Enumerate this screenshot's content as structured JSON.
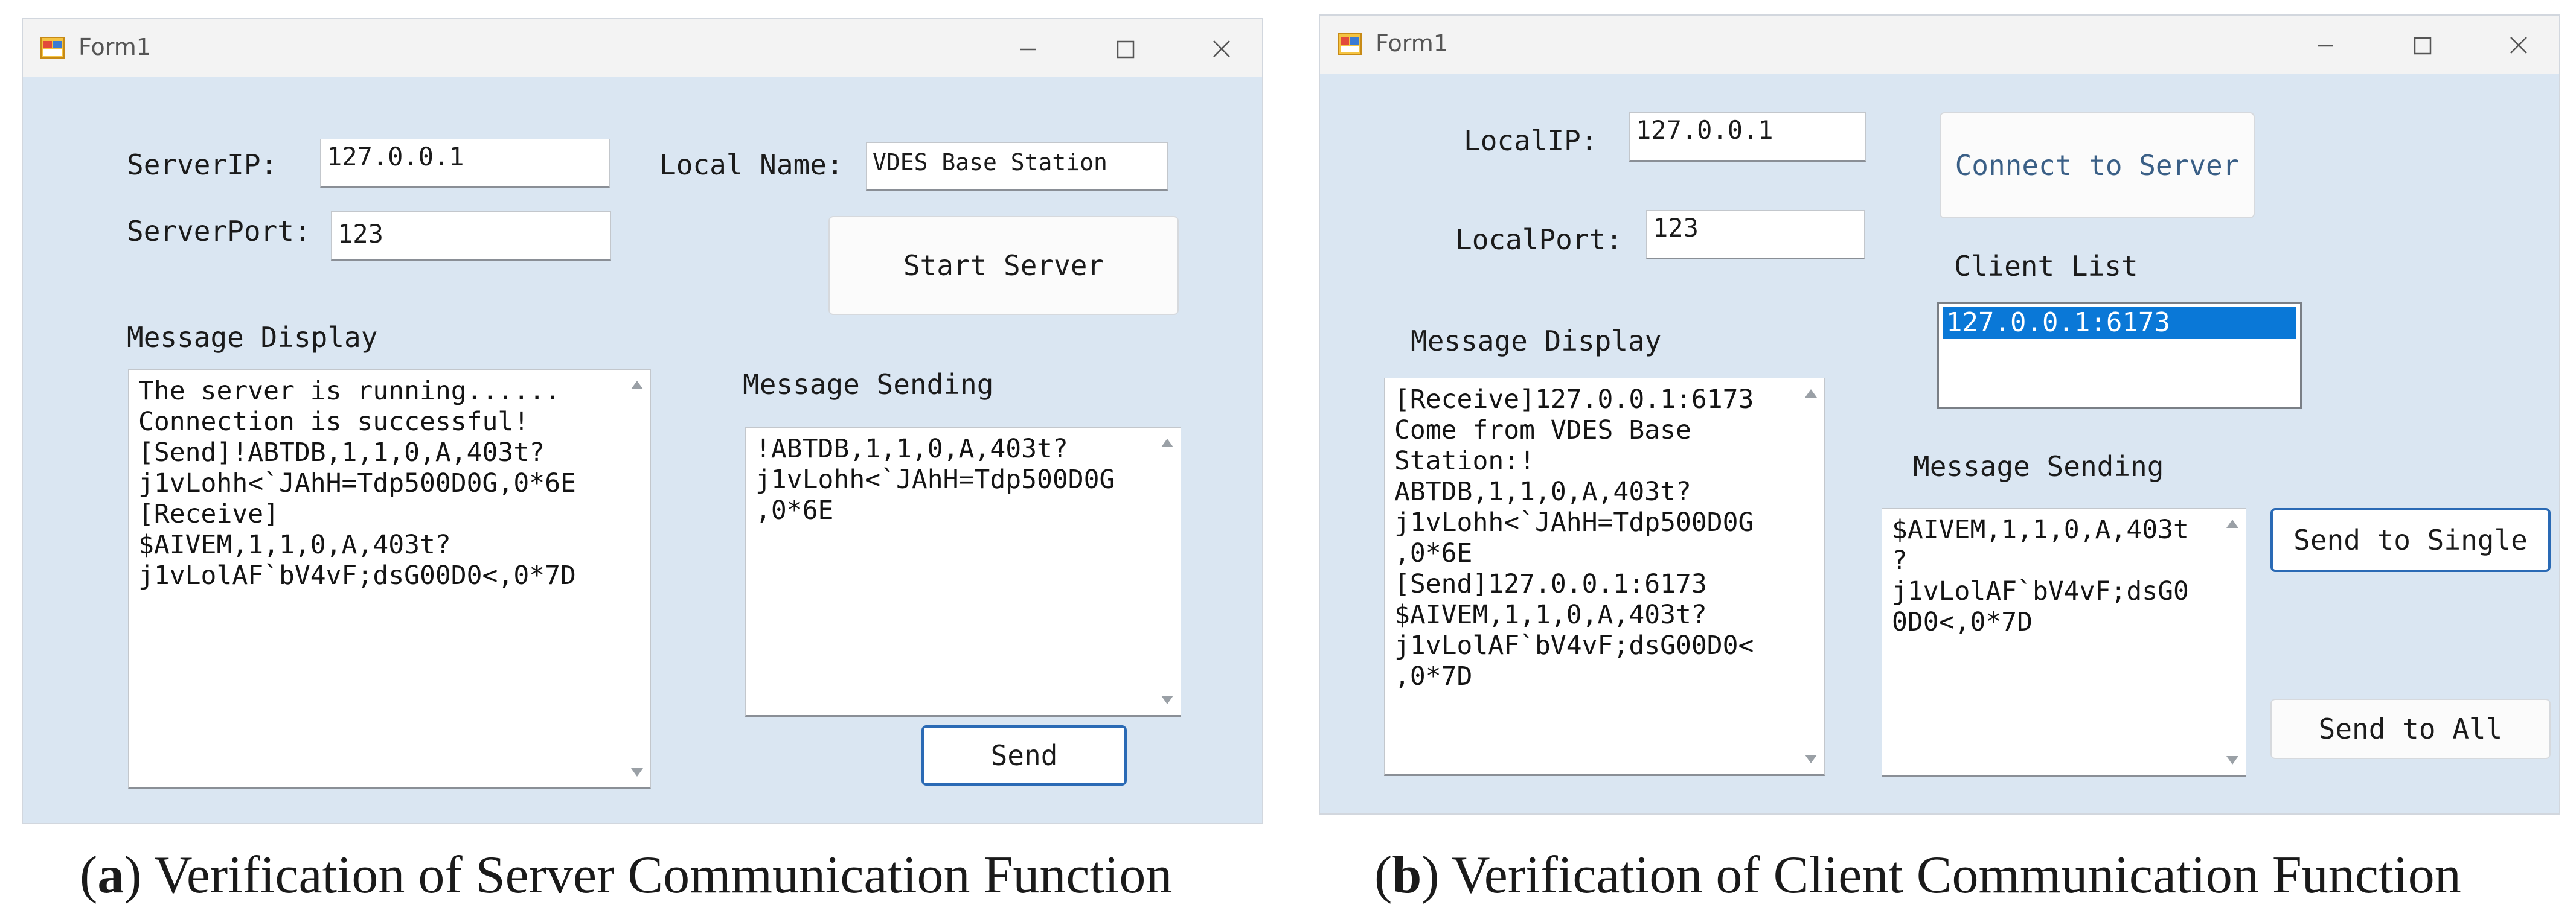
{
  "server_window": {
    "title": "Form1",
    "server_ip_label": "ServerIP:",
    "server_ip_value": "127.0.0.1",
    "local_name_label": "Local Name:",
    "local_name_value": "VDES Base Station",
    "server_port_label": "ServerPort:",
    "server_port_value": "123",
    "start_server_label": "Start Server",
    "message_display_label": "Message Display",
    "message_display_lines": [
      "The server is running......",
      "Connection is successful!",
      "[Send]!ABTDB,1,1,0,A,403t?",
      "j1vLohh<`JAhH=Tdp500D0G,0*6E",
      "[Receive]",
      "$AIVEM,1,1,0,A,403t?",
      "j1vLolAF`bV4vF;dsG00D0<,0*7D"
    ],
    "message_sending_label": "Message Sending",
    "message_sending_lines": [
      "!ABTDB,1,1,0,A,403t?",
      "j1vLohh<`JAhH=Tdp500D0G",
      ",0*6E"
    ],
    "send_label": "Send"
  },
  "client_window": {
    "title": "Form1",
    "local_ip_label": "LocalIP:",
    "local_ip_value": "127.0.0.1",
    "local_port_label": "LocalPort:",
    "local_port_value": "123",
    "connect_label": "Connect to Server",
    "client_list_label": "Client List",
    "client_list_items": [
      "127.0.0.1:6173"
    ],
    "message_display_label": "Message Display",
    "message_display_lines": [
      "[Receive]127.0.0.1:6173",
      "Come from VDES Base",
      "Station:!",
      "ABTDB,1,1,0,A,403t?",
      "j1vLohh<`JAhH=Tdp500D0G",
      ",0*6E",
      "[Send]127.0.0.1:6173",
      "$AIVEM,1,1,0,A,403t?",
      "j1vLolAF`bV4vF;dsG00D0<",
      ",0*7D"
    ],
    "message_sending_label": "Message Sending",
    "message_sending_lines": [
      "$AIVEM,1,1,0,A,403t",
      "?",
      "j1vLolAF`bV4vF;dsG0",
      "0D0<,0*7D"
    ],
    "send_single_label": "Send to Single",
    "send_all_label": "Send to All"
  },
  "captions": {
    "a_letter": "a",
    "a_text": "Verification of Server Communication Function",
    "b_letter": "b",
    "b_text": "Verification of Client Communication Function"
  },
  "colors": {
    "window_bg": "#dae6f2",
    "titlebar_bg": "#f3f3f3",
    "selection": "#0a78d7",
    "focus_border": "#2a6ab5"
  },
  "icons": [
    "app-icon",
    "minimize-icon",
    "maximize-icon",
    "close-icon",
    "scroll-up-icon",
    "scroll-down-icon"
  ]
}
